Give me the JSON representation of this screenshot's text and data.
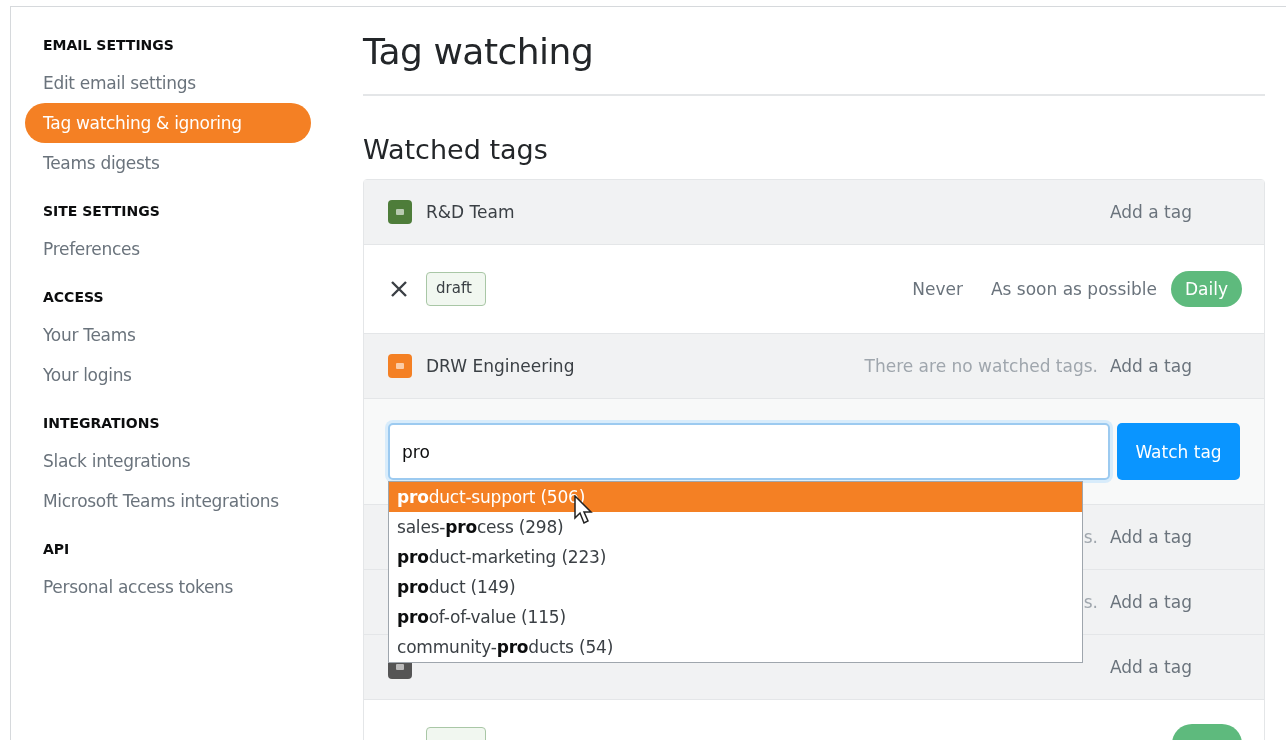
{
  "sidebar": {
    "sections": [
      {
        "heading": "EMAIL SETTINGS",
        "items": [
          {
            "label": "Edit email settings",
            "selected": false
          },
          {
            "label": "Tag watching & ignoring",
            "selected": true
          },
          {
            "label": "Teams digests",
            "selected": false
          }
        ]
      },
      {
        "heading": "SITE SETTINGS",
        "items": [
          {
            "label": "Preferences",
            "selected": false
          }
        ]
      },
      {
        "heading": "ACCESS",
        "items": [
          {
            "label": "Your Teams",
            "selected": false
          },
          {
            "label": "Your logins",
            "selected": false
          }
        ]
      },
      {
        "heading": "INTEGRATIONS",
        "items": [
          {
            "label": "Slack integrations",
            "selected": false
          },
          {
            "label": "Microsoft Teams integrations",
            "selected": false
          }
        ]
      },
      {
        "heading": "API",
        "items": [
          {
            "label": "Personal access tokens",
            "selected": false
          }
        ]
      }
    ]
  },
  "page_title": "Tag watching",
  "section_title": "Watched tags",
  "teams": [
    {
      "name": "R&D Team",
      "color": "#4e7d3a",
      "action": "Add a tag",
      "tags": [
        {
          "label": "draft",
          "frequencies": [
            {
              "label": "Never",
              "selected": false
            },
            {
              "label": "As soon as possible",
              "selected": false
            },
            {
              "label": "Daily",
              "selected": true
            }
          ]
        }
      ]
    },
    {
      "name": "DRW Engineering",
      "color": "#f48024",
      "status": "There are no watched tags.",
      "action": "Add a tag",
      "add_form": {
        "value": "pro",
        "button": "Watch tag",
        "suggestions": [
          {
            "text": "**pro**duct-support (506)",
            "selected": true
          },
          {
            "text": "sales-**pro**cess (298)",
            "selected": false
          },
          {
            "text": "**pro**duct-marketing (223)",
            "selected": false
          },
          {
            "text": "**pro**duct (149)",
            "selected": false
          },
          {
            "text": "**pro**of-of-value (115)",
            "selected": false
          },
          {
            "text": "community-**pro**ducts (54)",
            "selected": false
          }
        ]
      }
    },
    {
      "status": "s.",
      "action": "Add a tag"
    },
    {
      "status": "s.",
      "action": "Add a tag"
    },
    {
      "color": "#555555",
      "action": "Add a tag",
      "tags": [
        {
          "frequencies": [
            {
              "selected": true
            }
          ]
        }
      ]
    }
  ]
}
